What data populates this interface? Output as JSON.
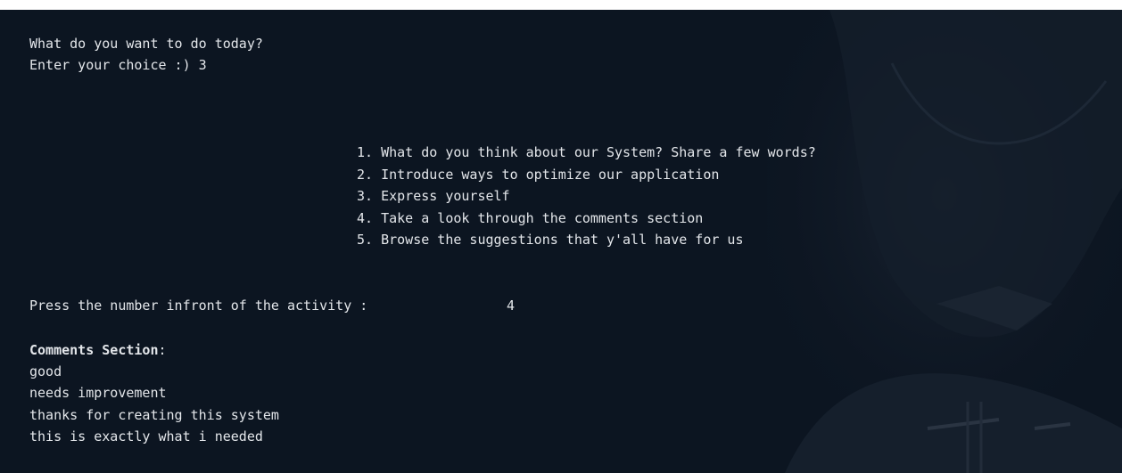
{
  "terminal": {
    "prompt_question": "What do you want to do today?",
    "choice_prompt": "Enter your choice :) 3",
    "menu_items": [
      "1. What do you think about our System? Share a few words?",
      "2. Introduce ways to optimize our application",
      "3. Express yourself",
      "4. Take a look through the comments section",
      "5. Browse the suggestions that y'all have for us"
    ],
    "activity_prompt": "Press the number infront of the activity :",
    "activity_value": "4",
    "comments_heading": "Comments Section",
    "comments_colon": ":",
    "comments": [
      "good",
      "needs improvement",
      "thanks for creating this system",
      "this is exactly what i needed"
    ]
  },
  "colors": {
    "background": "#0c1521",
    "text": "#e3e6ea"
  }
}
